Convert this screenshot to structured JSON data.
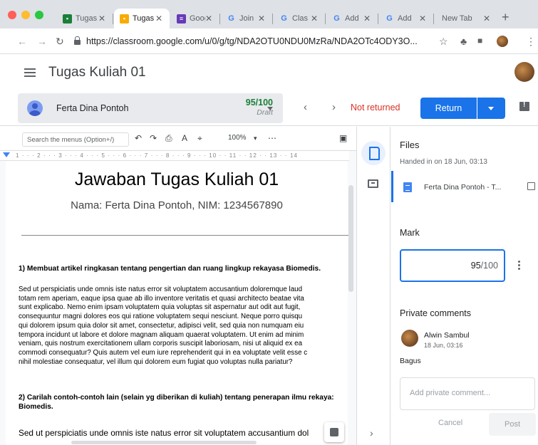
{
  "browser": {
    "tabs": [
      {
        "title": "Tugas",
        "icon": "classroom-icon",
        "color": "#188038",
        "active": false
      },
      {
        "title": "Tugas",
        "icon": "classroom-icon",
        "color": "#f9ab00",
        "active": true
      },
      {
        "title": "Goog",
        "icon": "forms-icon",
        "color": "#673ab7",
        "active": false
      },
      {
        "title": "Join",
        "icon": "google-icon",
        "color": "#4285f4",
        "active": false
      },
      {
        "title": "Clas",
        "icon": "google-icon",
        "color": "#4285f4",
        "active": false
      },
      {
        "title": "Add",
        "icon": "google-icon",
        "color": "#4285f4",
        "active": false
      },
      {
        "title": "Add",
        "icon": "google-icon",
        "color": "#4285f4",
        "active": false
      },
      {
        "title": "New Tab",
        "icon": "",
        "color": "",
        "active": false
      }
    ],
    "url": "https://classroom.google.com/u/0/g/tg/NDA2OTU0NDU0MzRa/NDA2OTc4ODY3O..."
  },
  "header": {
    "title": "Tugas Kuliah 01"
  },
  "student_bar": {
    "name": "Ferta Dina Pontoh",
    "grade": "95/100",
    "grade_status": "Draft",
    "status": "Not returned",
    "return_label": "Return"
  },
  "doc": {
    "search_placeholder": "Search the menus (Option+/)",
    "zoom": "100%",
    "ruler": "1 · · · 2 · · · 3 · · · 4 · · · 5 · · · 6 · · · 7 · · · 8 · · · 9 · · · 10 · · 11 · · 12 · · 13 · · 14",
    "heading": "Jawaban Tugas Kuliah 01",
    "subheading": "Nama: Ferta Dina Pontoh, NIM: 1234567890",
    "q1": "1) Membuat artikel ringkasan tentang pengertian dan ruang lingkup rekayasa Biomedis.",
    "p1": [
      "Sed ut perspiciatis unde omnis iste natus error sit voluptatem accusantium doloremque laud",
      "totam rem aperiam, eaque ipsa quae ab illo inventore veritatis et quasi architecto beatae vita",
      "sunt explicabo. Nemo enim ipsam voluptatem quia voluptas sit aspernatur aut odit aut fugit,",
      "consequuntur magni dolores eos qui ratione voluptatem sequi nesciunt. Neque porro quisqu",
      "qui dolorem ipsum quia dolor sit amet, consectetur, adipisci velit, sed quia non numquam eiu",
      "tempora incidunt ut labore et dolore magnam aliquam quaerat voluptatem. Ut enim ad minim",
      "veniam, quis nostrum exercitationem ullam corporis suscipit laboriosam, nisi ut aliquid ex ea",
      "commodi consequatur? Quis autem vel eum iure reprehenderit qui in ea voluptate velit esse c",
      "nihil molestiae consequatur, vel illum qui dolorem eum fugiat quo voluptas nulla pariatur?"
    ],
    "q2": [
      "2) Carilah contoh-contoh lain (selain yg diberikan di kuliah) tentang penerapan ilmu rekaya:",
      "Biomedis."
    ],
    "p2": "Sed ut perspiciatis unde omnis iste natus error sit voluptatem accusantium dol"
  },
  "panel": {
    "files_label": "Files",
    "handed_in": "Handed in on 18 Jun, 03:13",
    "file_name": "Ferta Dina Pontoh - T...",
    "mark_label": "Mark",
    "mark_value": "95",
    "mark_total": "/100",
    "private_label": "Private comments",
    "comment": {
      "author": "Alwin Sambul",
      "time": "18 Jun, 03:16",
      "text": "Bagus"
    },
    "comment_placeholder": "Add private comment...",
    "cancel_label": "Cancel",
    "post_label": "Post"
  },
  "colors": {
    "accent": "#1a73e8",
    "grade_green": "#188038",
    "not_returned_red": "#d93025"
  }
}
